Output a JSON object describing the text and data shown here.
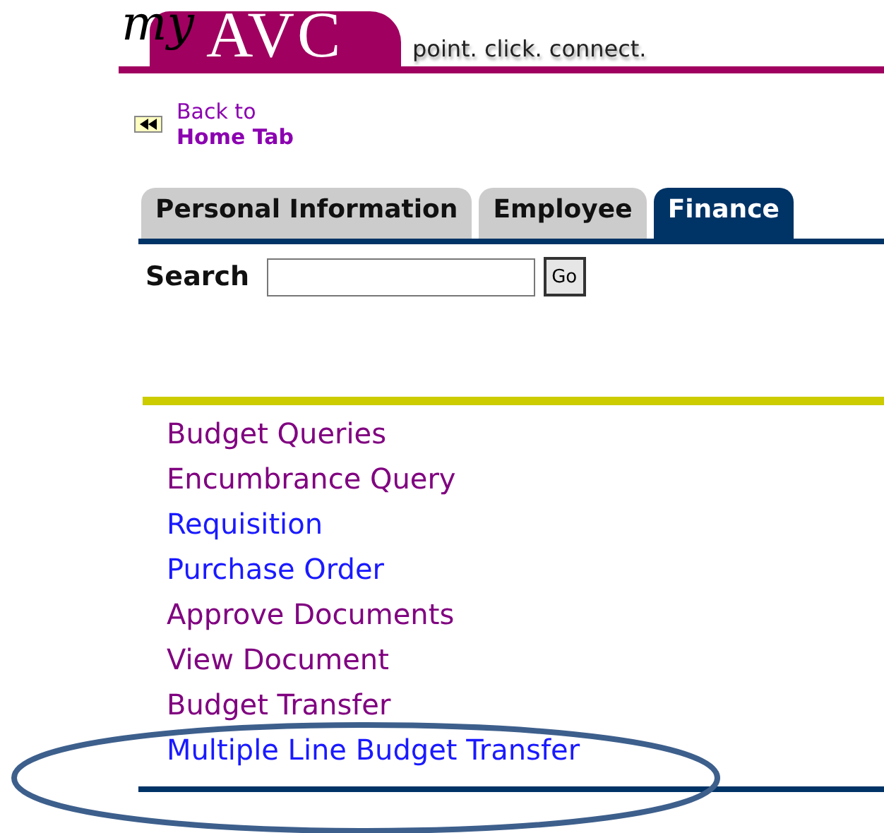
{
  "header": {
    "logo_script": "my",
    "logo": "AVC",
    "tagline": "point. click. connect."
  },
  "back_link": {
    "line_1": "Back to",
    "line_2": "Home Tab"
  },
  "tabs": [
    {
      "label": "Personal Information",
      "selected": false
    },
    {
      "label": "Employee",
      "selected": false
    },
    {
      "label": "Finance",
      "selected": true
    }
  ],
  "search": {
    "label": "Search",
    "button": "Go"
  },
  "links": [
    {
      "label": "Budget Queries",
      "visited": true
    },
    {
      "label": "Encumbrance Query",
      "visited": true
    },
    {
      "label": "Requisition",
      "visited": false
    },
    {
      "label": "Purchase Order",
      "visited": false
    },
    {
      "label": "Approve Documents",
      "visited": true
    },
    {
      "label": "View Document",
      "visited": true
    },
    {
      "label": "Budget Transfer",
      "visited": true
    },
    {
      "label": "Multiple Line Budget Transfer",
      "visited": false
    }
  ]
}
